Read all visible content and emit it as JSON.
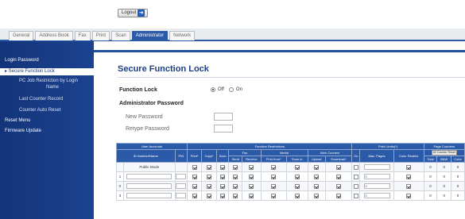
{
  "logout": {
    "label": "Logout"
  },
  "tabs": [
    {
      "label": "General"
    },
    {
      "label": "Address Book"
    },
    {
      "label": "Fax"
    },
    {
      "label": "Print"
    },
    {
      "label": "Scan"
    },
    {
      "label": "Administrator"
    },
    {
      "label": "Network"
    }
  ],
  "sidebar": {
    "items": [
      {
        "label": "Login Password"
      },
      {
        "label": "▸ Secure Function Lock"
      },
      {
        "label": "PC Job Restriction by Login"
      },
      {
        "label": "Name"
      },
      {
        "label": "Last Counter Record"
      },
      {
        "label": "Counter Auto Reset"
      },
      {
        "label": "Reset Menu"
      },
      {
        "label": "Firmware Update"
      }
    ]
  },
  "page": {
    "title": "Secure Function Lock",
    "function_lock_label": "Function Lock",
    "option_off": "Off",
    "option_on": "On",
    "admin_password_label": "Administrator Password",
    "new_password_label": "New Password",
    "retype_password_label": "Retype Password"
  },
  "table": {
    "group_headers": {
      "user_accounts": "User Accounts",
      "function_restrictions": "Function Restrictions",
      "print_limits": "Print Limits(*)",
      "page_counters": "Page Counters"
    },
    "sub_headers": {
      "fax": "Fax",
      "media": "Media",
      "web_connect": "Web Connect",
      "all_counter_reset": "All Counter Reset"
    },
    "columns": {
      "id_number_name": "ID Number/Name",
      "pin": "PIN",
      "print": "Print*",
      "copy": "Copy*",
      "scan": "Scan",
      "send": "Send",
      "receive": "Receive",
      "print_from": "Print from*",
      "scan_to": "Scan to",
      "upload": "Upload",
      "download": "Download*",
      "on": "On",
      "max_pages": "Max. Pages",
      "color_restrict": "Color Restrict",
      "total": "Total",
      "bw": "B&W",
      "color": "Color"
    },
    "rows": [
      {
        "index": "",
        "name": "Public Mode",
        "max_pages": "",
        "total": "0",
        "bw": "0",
        "color": "0"
      },
      {
        "index": "1",
        "name": "",
        "max_pages": "0",
        "total": "0",
        "bw": "0",
        "color": "0"
      },
      {
        "index": "2",
        "name": "",
        "max_pages": "0",
        "total": "0",
        "bw": "0",
        "color": "0"
      },
      {
        "index": "3",
        "name": "",
        "max_pages": "0",
        "total": "0",
        "bw": "0",
        "color": "0"
      }
    ]
  }
}
